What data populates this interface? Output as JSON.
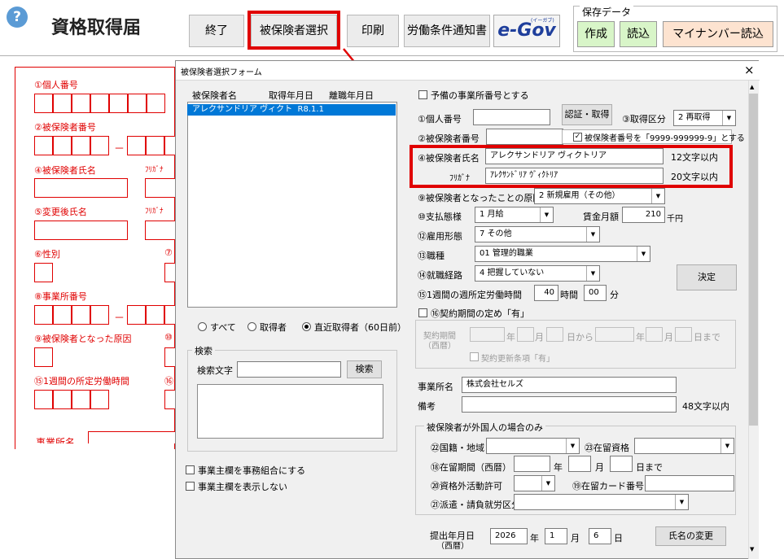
{
  "header": {
    "help_glyph": "?",
    "title": "資格取得届"
  },
  "toolbar": {
    "end": "終了",
    "select_insured": "被保険者選択",
    "print": "印刷",
    "labor_notice": "労働条件通知書",
    "egov": "e-Gov",
    "egov_ruby": "(イーガブ)"
  },
  "save_data": {
    "label": "保存データ",
    "create": "作成",
    "load": "読込",
    "mynumber_load": "マイナンバー読込"
  },
  "bg_form": {
    "f1": "①個人番号",
    "f2": "②被保険者番号",
    "f4": "④被保険者氏名",
    "f4_kana": "ﾌﾘｶﾞﾅ",
    "f5": "⑤変更後氏名",
    "f5_kana": "ﾌﾘｶﾞﾅ",
    "f6": "⑥性別",
    "f6_partial": "⑦",
    "f8": "⑧事業所番号",
    "f9": "⑨被保険者となった原因",
    "f9_partial": "⑩",
    "f15": "⑮1週間の所定労働時間",
    "f15_partial": "⑯",
    "f_office": "事業所名",
    "dash": "－"
  },
  "dialog": {
    "title": "被保険者選択フォーム",
    "close": "×",
    "list": {
      "headers": [
        "被保険者名",
        "取得年月日",
        "離職年月日"
      ],
      "rows": [
        {
          "name": "アレクサンドリア ヴィクト",
          "date": "R8.1.1"
        }
      ]
    },
    "filters": {
      "all": "すべて",
      "acquirer": "取得者",
      "recent": "直近取得者（60日前）",
      "selected": "recent"
    },
    "search": {
      "group": "検索",
      "label": "検索文字",
      "value": "",
      "button": "検索"
    },
    "opt_office_union": "事業主欄を事務組合にする",
    "opt_hide_owner": "事業主欄を表示しない",
    "right": {
      "spare_office": "予備の事業所番号とする",
      "f1": "①個人番号",
      "f1_value": "",
      "auth_button": "認証・取得",
      "f3": "③取得区分",
      "f3_value": "2 再取得",
      "f2": "②被保険者番号",
      "f2_value": "",
      "f2_check": "被保険者番号を「9999-999999-9」とする",
      "f4": "④被保険者氏名",
      "f4_value": "アレクサンドリア ヴィクトリア",
      "f4_limit": "12文字以内",
      "kana": "ﾌﾘｶﾞﾅ",
      "kana_value": "ｱﾚｸｻﾝﾄﾞﾘｱ ｳﾞｨｸﾄﾘｱ",
      "kana_limit": "20文字以内",
      "f9": "⑨被保険者となったことの原因",
      "f9_value": "2 新規雇用（その他）",
      "f10": "⑩支払態様",
      "f10_value": "1 月給",
      "wage": "賃金月額",
      "wage_value": "210",
      "wage_unit": "千円",
      "f12": "⑫雇用形態",
      "f12_value": "7 その他",
      "f13": "⑬職種",
      "f13_value": "01 管理的職業",
      "f14": "⑭就職経路",
      "f14_value": "4 把握していない",
      "decide": "決定",
      "f15": "⑮1週間の週所定労働時間",
      "hours": "40",
      "hours_unit": "時間",
      "minutes": "00",
      "minutes_unit": "分",
      "f16": "⑯契約期間の定め「有」",
      "contract_label": "契約期間",
      "contract_era": "（西暦）",
      "c_year": "年",
      "c_month": "月",
      "c_from": "日から",
      "c_year2": "年",
      "c_month2": "月",
      "c_until": "日まで",
      "c_renew": "契約更新条項「有」",
      "office": "事業所名",
      "office_value": "株式会社セルズ",
      "note": "備考",
      "note_value": "",
      "note_limit": "48文字以内",
      "foreign_group": "被保険者が外国人の場合のみ",
      "f22": "㉒国籍・地域",
      "f23": "㉓在留資格",
      "f18": "⑱在留期間（西暦）",
      "f18_year": "年",
      "f18_month": "月",
      "f18_until": "日まで",
      "f20": "⑳資格外活動許可",
      "f19": "⑲在留カード番号",
      "f21": "㉑派遣・請負就労区分",
      "submit_label": "提出年月日",
      "submit_era": "（西暦）",
      "submit_year": "2026",
      "submit_month": "1",
      "submit_day": "6",
      "y": "年",
      "m": "月",
      "d": "日",
      "rename": "氏名の変更"
    }
  },
  "colors": {
    "highlight": "#e00000",
    "selection": "#0078d7",
    "green_button": "#d8f5c8",
    "pink_button": "#fde3d0"
  }
}
